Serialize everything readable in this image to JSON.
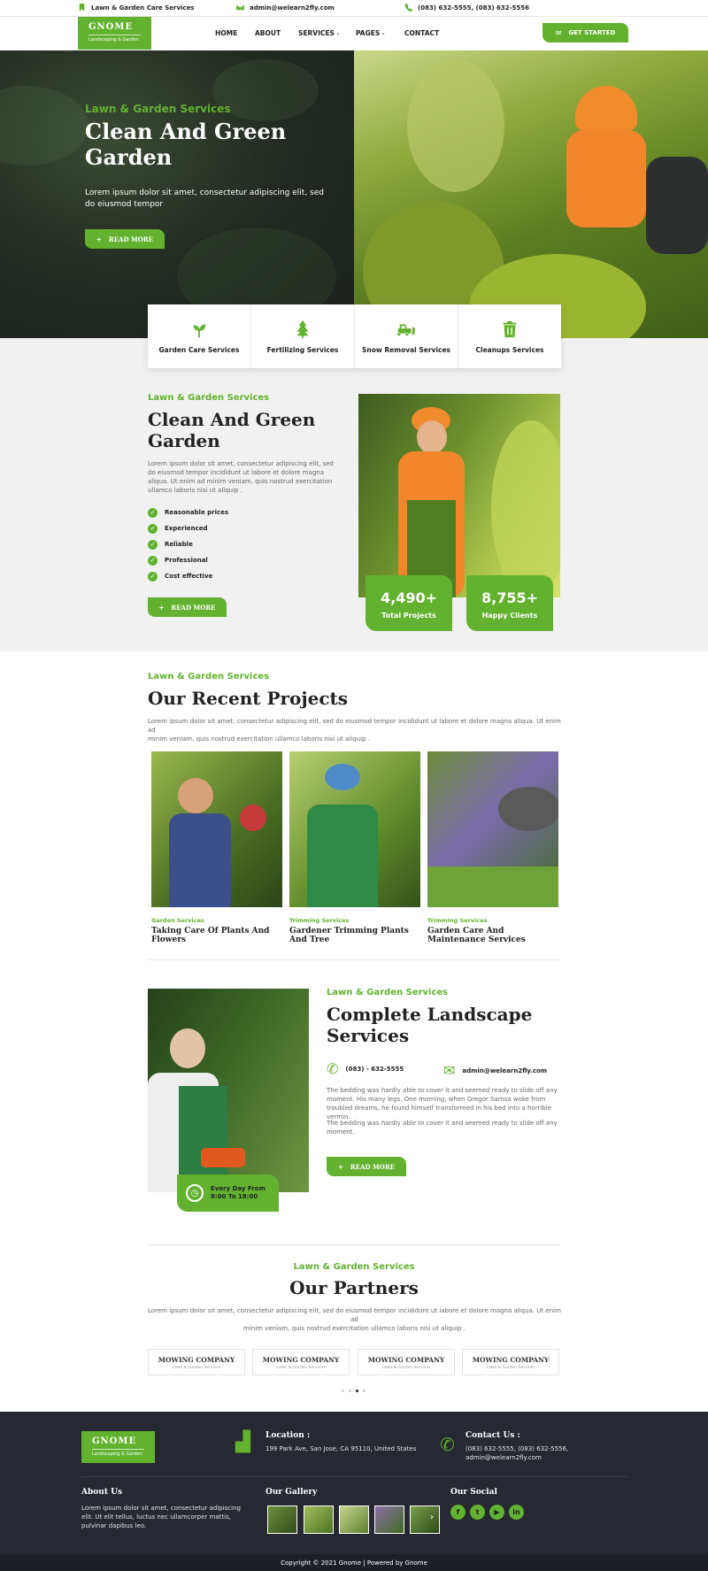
{
  "topbar": {
    "tagline": "Lawn & Garden Care Services",
    "email": "admin@welearn2fly.com",
    "phones": "(083) 632-5555, (083) 632-5556"
  },
  "brand": {
    "name": "GNOME",
    "tagline": "Landscaping & Garden"
  },
  "nav": {
    "items": [
      "HOME",
      "ABOUT",
      "SERVICES",
      "PAGES",
      "CONTACT"
    ],
    "cta": "GET STARTED"
  },
  "hero": {
    "eyebrow": "Lawn & Garden Services",
    "title_line1": "Clean And Green",
    "title_line2": "Garden",
    "text": "Lorem ipsum dolor sit amet, consectetur adipiscing elit, sed do eiusmod tempor",
    "button": "READ MORE"
  },
  "services": [
    {
      "label": "Garden Care Services",
      "icon": "sprout-icon"
    },
    {
      "label": "Fertilizing Services",
      "icon": "tree-icon"
    },
    {
      "label": "Snow Removal Services",
      "icon": "snowplow-icon"
    },
    {
      "label": "Cleanups Services",
      "icon": "trash-icon"
    }
  ],
  "about": {
    "eyebrow": "Lawn & Garden Services",
    "title_line1": "Clean And Green",
    "title_line2": "Garden",
    "text": "Lorem ipsum dolor sit amet, consectetur adipiscing elit, sed do eiusmod tempor incididunt ut labore et dolore magna aliqua. Ut enim ad minim veniam, quis nostrud exercitation ullamco laboris nisi ut aliquip .",
    "checklist": [
      "Reasonable prices",
      "Experienced",
      "Reliable",
      "Professional",
      "Cost effective"
    ],
    "button": "READ MORE",
    "stats": [
      {
        "value": "4,490+",
        "label": "Total Projects"
      },
      {
        "value": "8,755+",
        "label": "Happy Clients"
      }
    ]
  },
  "projects": {
    "eyebrow": "Lawn & Garden Services",
    "title": "Our Recent Projects",
    "text_line1": "Lorem ipsum dolor sit amet, consectetur adipiscing elit, sed do eiusmod tempor incididunt ut labore et dolore magna aliqua. Ut enim ad",
    "text_line2": "minim veniam, quis nostrud exercitation ullamco laboris nisi ut aliquip .",
    "items": [
      {
        "category": "Garden Services",
        "title": "Taking Care Of Plants And Flowers"
      },
      {
        "category": "Trimming Services",
        "title": "Gardener Trimming Plants And Tree"
      },
      {
        "category": "Trimming Services",
        "title": "Garden Care And Maintenance Services"
      }
    ]
  },
  "landscape": {
    "eyebrow": "Lawn & Garden Services",
    "title_line1": "Complete Landscape",
    "title_line2": "Services",
    "phone": "(083) - 632-5555",
    "email": "admin@welearn2fly.com",
    "text1": "The bedding was hardly able to cover it and seemed ready to slide off any moment. His many legs. One morning, when Gregor Samsa woke from troubled dreams, he found himself transformed in his bed into a horrible vermin.",
    "text2": "The bedding was hardly able to cover it and seemed ready to slide off any moment.",
    "button": "READ MORE",
    "hours_line1": "Every Day From",
    "hours_line2": "8:00 To 18:00"
  },
  "partners": {
    "eyebrow": "Lawn & Garden Services",
    "title": "Our Partners",
    "text_line1": "Lorem ipsum dolor sit amet, consectetur adipiscing elit, sed do eiusmod tempor incididunt ut labore et dolore magna aliqua. Ut enim ad",
    "text_line2": "minim veniam, quis nostrud exercitation ullamco laboris nisi ut aliquip .",
    "items": [
      {
        "name": "MOWING COMPANY",
        "sub": "Lawn & Garden Services"
      },
      {
        "name": "MOWING COMPANY",
        "sub": "Lawn & Garden Services"
      },
      {
        "name": "MOWING COMPANY",
        "sub": "Lawn & Garden Services"
      },
      {
        "name": "MOWING COMPANY",
        "sub": "Lawn & Garden Services"
      }
    ],
    "active_dot": 3
  },
  "footer": {
    "location_title": "Location :",
    "location_text": "199 Park Ave, San Jose, CA 95110, United States",
    "contact_title": "Contact Us :",
    "contact_phones": "(083) 632-5555, (083) 632-5556,",
    "contact_email": "admin@welearn2fly.com",
    "about_title": "About Us",
    "about_text": "Lorem ipsum dolor sit amet, consectetur adipiscing elit. Ut elit tellus, luctus nec ullamcorper mattis, pulvinar dapibus leo.",
    "gallery_title": "Our Gallery",
    "social_title": "Our Social",
    "social": [
      "facebook-icon",
      "twitter-icon",
      "youtube-icon",
      "linkedin-icon"
    ],
    "copyright": "Copyright © 2021 Gnome | Powered by Gnome"
  },
  "colors": {
    "accent": "#62b22f",
    "footer_bg": "#262832",
    "section_bg": "#f1f1f1"
  }
}
